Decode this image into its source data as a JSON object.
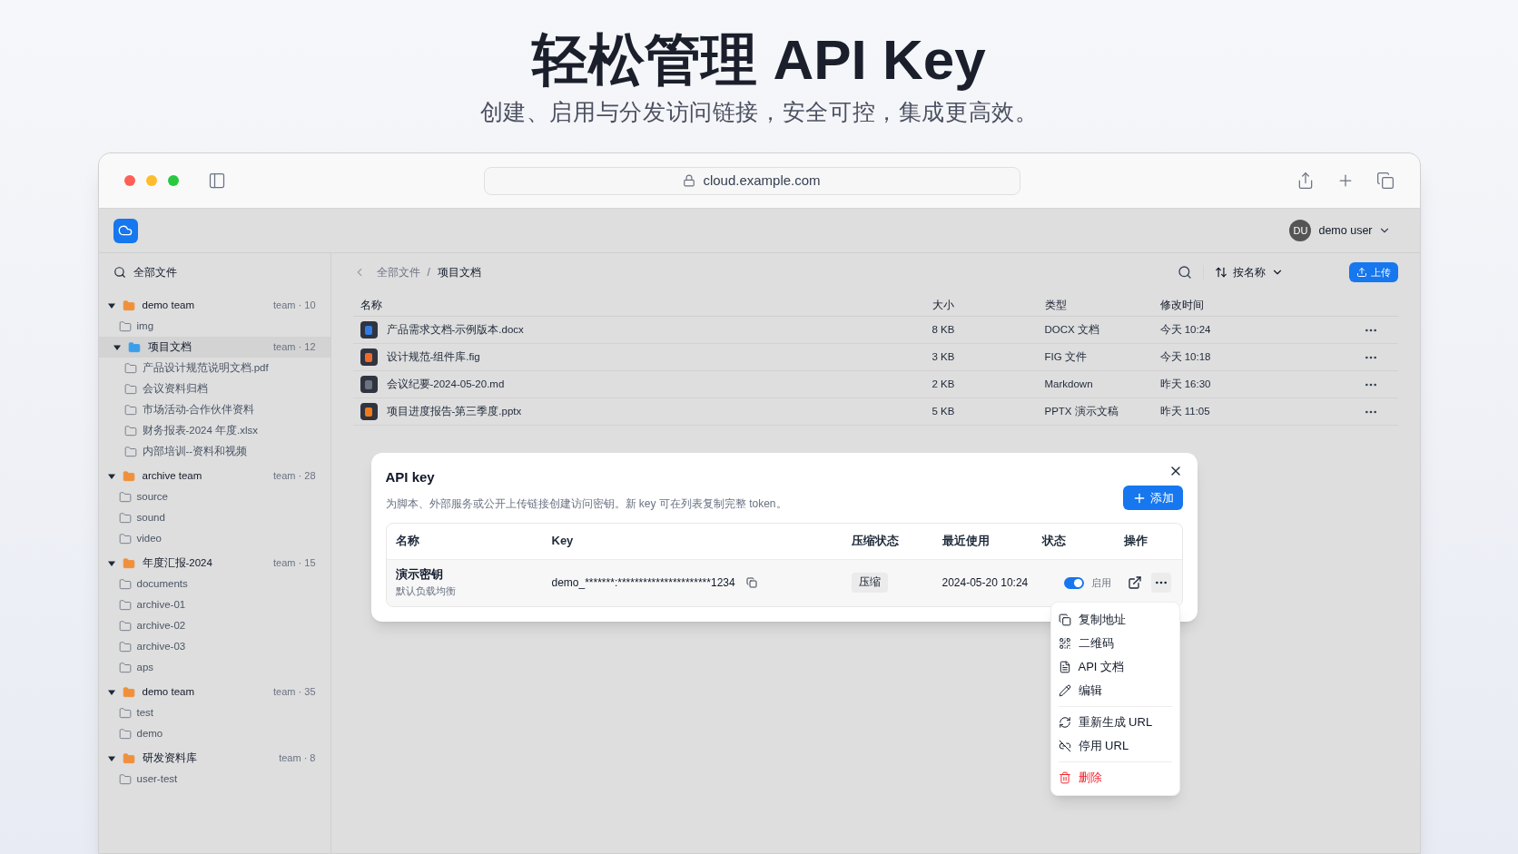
{
  "hero": {
    "title": "轻松管理 API Key",
    "subtitle": "创建、启用与分发访问链接，安全可控，集成更高效。"
  },
  "browser": {
    "url": "cloud.example.com"
  },
  "app_header": {
    "avatar": "DU",
    "user": "demo user"
  },
  "sidebar": {
    "all_files": "全部文件",
    "tree": [
      {
        "label": "demo team",
        "count": "team · 10",
        "expanded": true,
        "selected": false,
        "children": [
          {
            "label": "img"
          },
          {
            "label": "项目文档",
            "count": "team · 12",
            "expanded": true,
            "selected": true,
            "children": [
              {
                "label": "产品设计规范说明文档.pdf"
              },
              {
                "label": "会议资料归档"
              },
              {
                "label": "市场活动-合作伙伴资料"
              },
              {
                "label": "财务报表-2024 年度.xlsx"
              },
              {
                "label": "内部培训--资料和视频"
              }
            ]
          }
        ]
      },
      {
        "label": "archive team",
        "count": "team · 28",
        "expanded": true,
        "selected": false,
        "children": [
          {
            "label": "source"
          },
          {
            "label": "sound"
          },
          {
            "label": "video"
          }
        ]
      },
      {
        "label": "年度汇报-2024",
        "count": "team · 15",
        "expanded": true,
        "selected": false,
        "children": [
          {
            "label": "documents"
          },
          {
            "label": "archive-01"
          },
          {
            "label": "archive-02"
          },
          {
            "label": "archive-03"
          },
          {
            "label": "aps"
          }
        ]
      },
      {
        "label": "demo team",
        "count": "team · 35",
        "expanded": true,
        "selected": false,
        "children": [
          {
            "label": "test"
          },
          {
            "label": "demo"
          }
        ]
      },
      {
        "label": "研发资料库",
        "count": "team · 8",
        "expanded": true,
        "selected": false,
        "children": [
          {
            "label": "user-test"
          }
        ]
      }
    ]
  },
  "toolbar": {
    "breadcrumb": [
      "全部文件",
      "项目文档"
    ],
    "separator": "/",
    "sort": "按名称",
    "upload": "上传"
  },
  "files": {
    "columns": [
      "名称",
      "大小",
      "类型",
      "修改时间"
    ],
    "rows": [
      {
        "name": "产品需求文档-示例版本.docx",
        "size": "8 KB",
        "type": "DOCX 文档",
        "modified": "今天 10:24",
        "color": "#2f7de1"
      },
      {
        "name": "设计规范-组件库.fig",
        "size": "3 KB",
        "type": "FIG 文件",
        "modified": "今天 10:18",
        "color": "#f06a2a"
      },
      {
        "name": "会议纪要-2024-05-20.md",
        "size": "2 KB",
        "type": "Markdown",
        "modified": "昨天 16:30",
        "color": "#6b7280"
      },
      {
        "name": "项目进度报告-第三季度.pptx",
        "size": "5 KB",
        "type": "PPTX 演示文稿",
        "modified": "昨天 11:05",
        "color": "#f07a1a"
      }
    ]
  },
  "dialog": {
    "title": "API key",
    "description": "为脚本、外部服务或公开上传链接创建访问密钥。新 key 可在列表复制完整 token。",
    "add": "添加",
    "columns": [
      "名称",
      "Key",
      "压缩状态",
      "最近使用",
      "状态",
      "操作"
    ],
    "rows": [
      {
        "name": "演示密钥",
        "note": "默认负载均衡",
        "key": "demo_*******:**********************1234",
        "compression": "压缩",
        "last_used": "2024-05-20 10:24",
        "on": true,
        "status": "启用"
      }
    ]
  },
  "menu": {
    "groups": [
      [
        {
          "label": "复制地址",
          "kind": "normal"
        },
        {
          "label": "二维码",
          "kind": "normal"
        },
        {
          "label": "API 文档",
          "kind": "normal"
        },
        {
          "label": "编辑",
          "kind": "normal"
        }
      ],
      [
        {
          "label": "重新生成 URL",
          "kind": "normal"
        },
        {
          "label": "停用 URL",
          "kind": "normal"
        }
      ],
      [
        {
          "label": "删除",
          "kind": "danger"
        }
      ]
    ]
  }
}
